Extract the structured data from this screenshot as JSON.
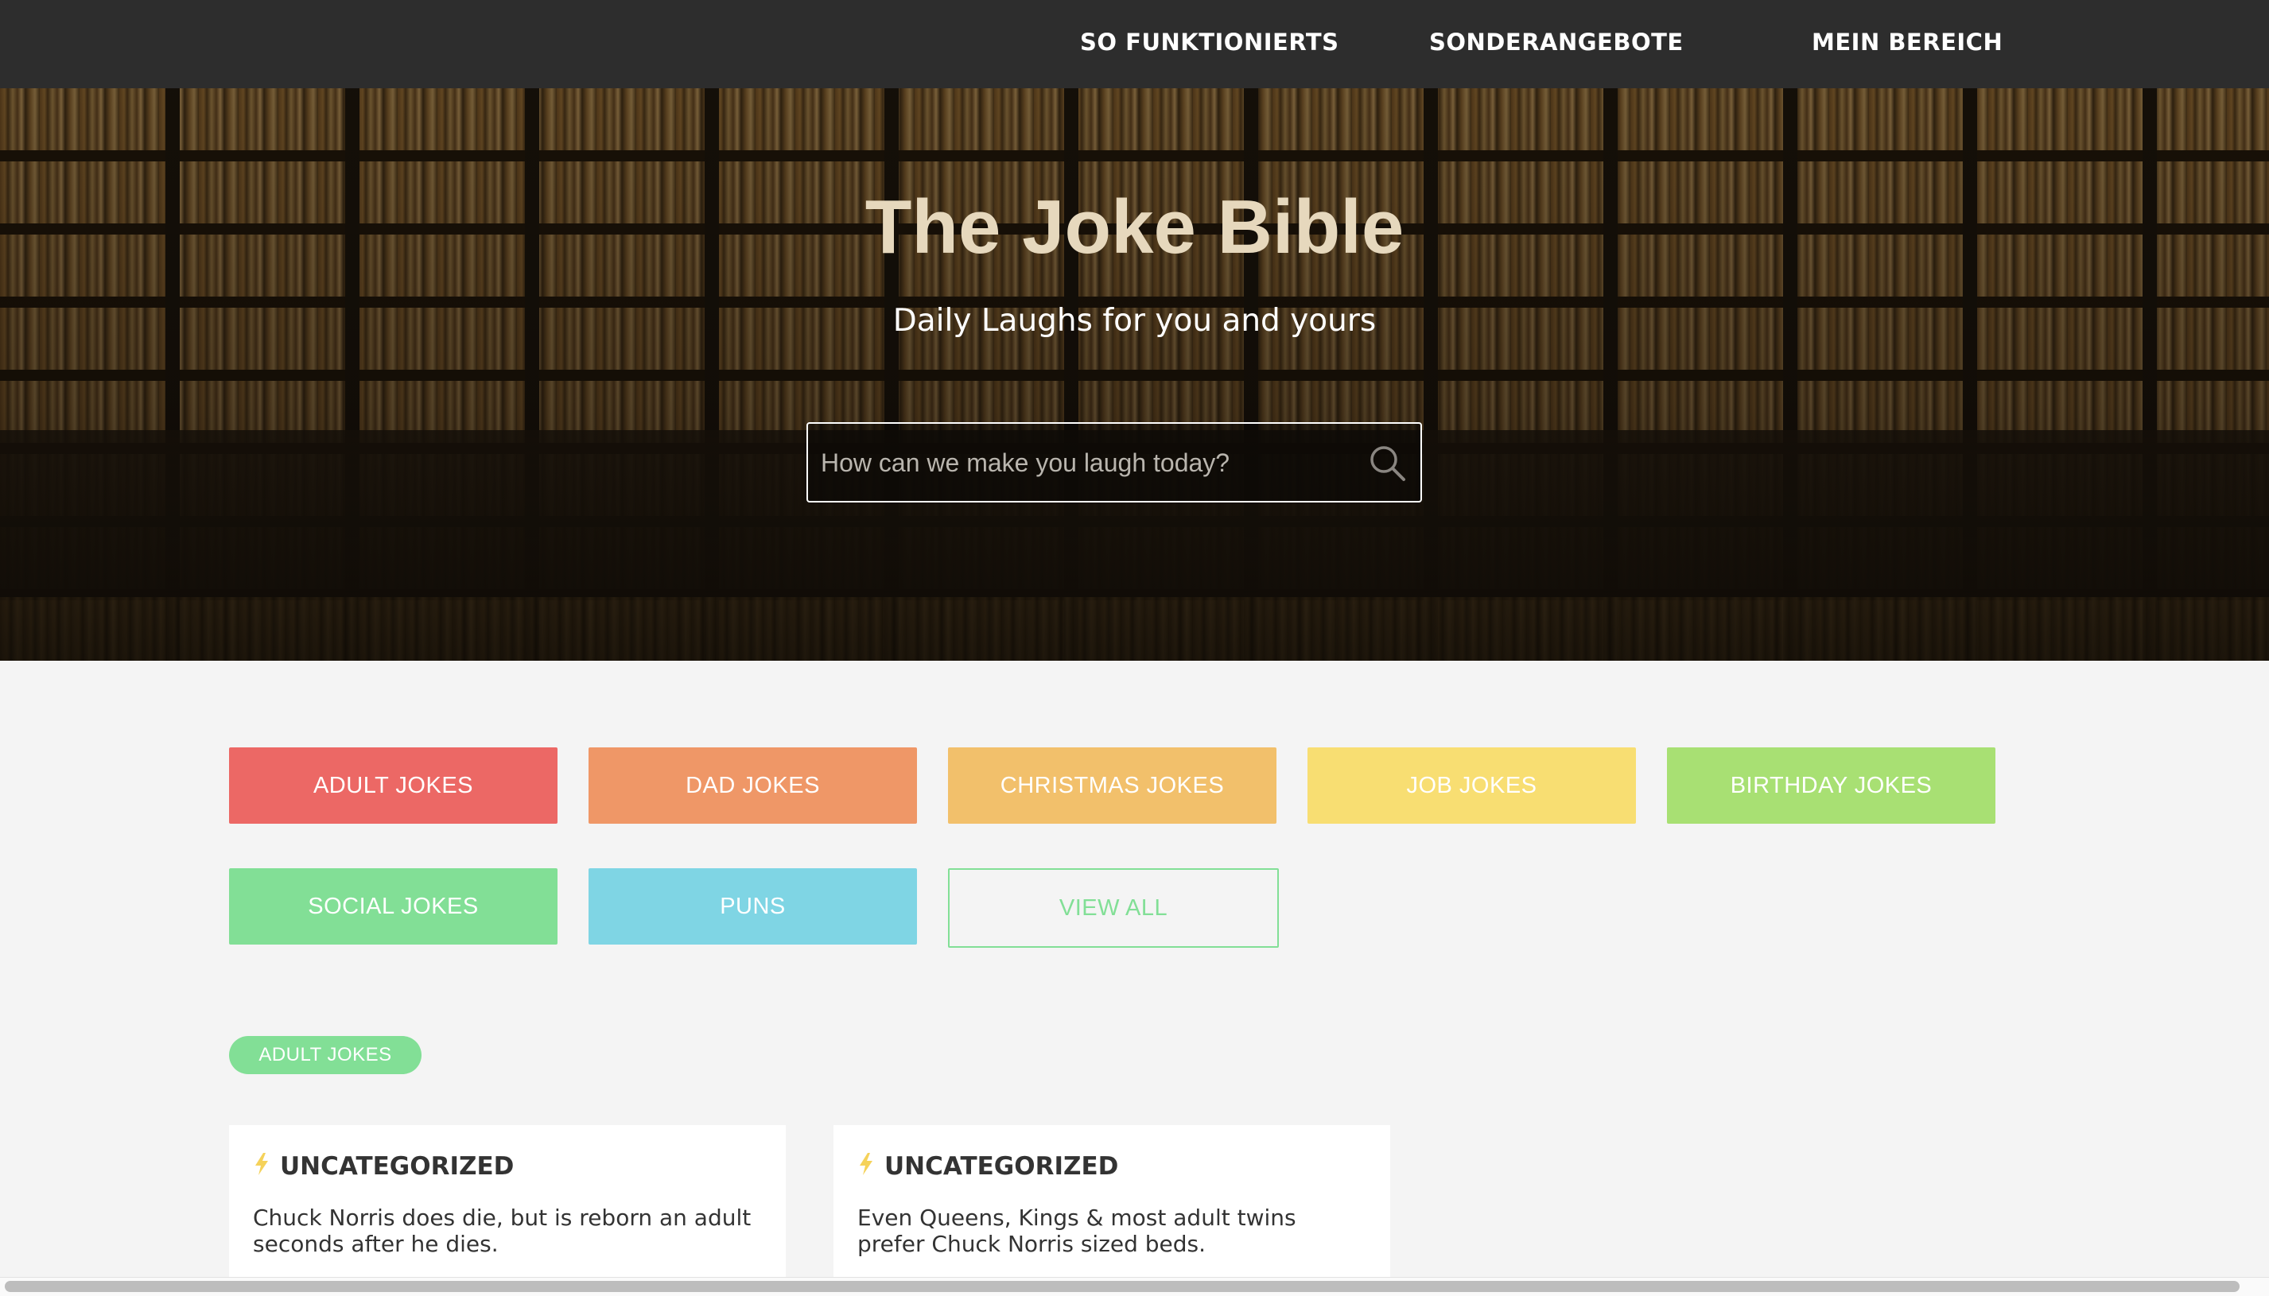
{
  "nav": {
    "links": [
      "SO FUNKTIONIERTS",
      "SONDERANGEBOTE",
      "MEIN BEREICH"
    ]
  },
  "hero": {
    "title": "The Joke Bible",
    "subtitle": "Daily Laughs for you and yours",
    "search_placeholder": "How can we make you laugh today?",
    "search_icon": "search-icon"
  },
  "categories": [
    {
      "label": "ADULT JOKES",
      "color": "#ec6865"
    },
    {
      "label": "DAD JOKES",
      "color": "#ef9767"
    },
    {
      "label": "CHRISTMAS JOKES",
      "color": "#f2c06b"
    },
    {
      "label": "JOB JOKES",
      "color": "#f8de72"
    },
    {
      "label": "BIRTHDAY JOKES",
      "color": "#a8e073"
    },
    {
      "label": "SOCIAL JOKES",
      "color": "#82df96"
    },
    {
      "label": "PUNS",
      "color": "#7fd5e4"
    },
    {
      "label": "VIEW ALL",
      "color": "#82df96"
    }
  ],
  "section": {
    "tag": "ADULT JOKES",
    "tag_color": "#82df96"
  },
  "cards": [
    {
      "icon": "lightning-bolt-icon",
      "category": "UNCATEGORIZED",
      "text": "Chuck Norris does die, but is reborn an adult seconds after he dies."
    },
    {
      "icon": "lightning-bolt-icon",
      "category": "UNCATEGORIZED",
      "text": "Even Queens, Kings & most adult twins prefer Chuck Norris sized beds."
    }
  ],
  "colors": {
    "nav_bg": "#2d2d2d",
    "page_bg": "#f4f4f4",
    "bolt": "#f5d25a"
  }
}
